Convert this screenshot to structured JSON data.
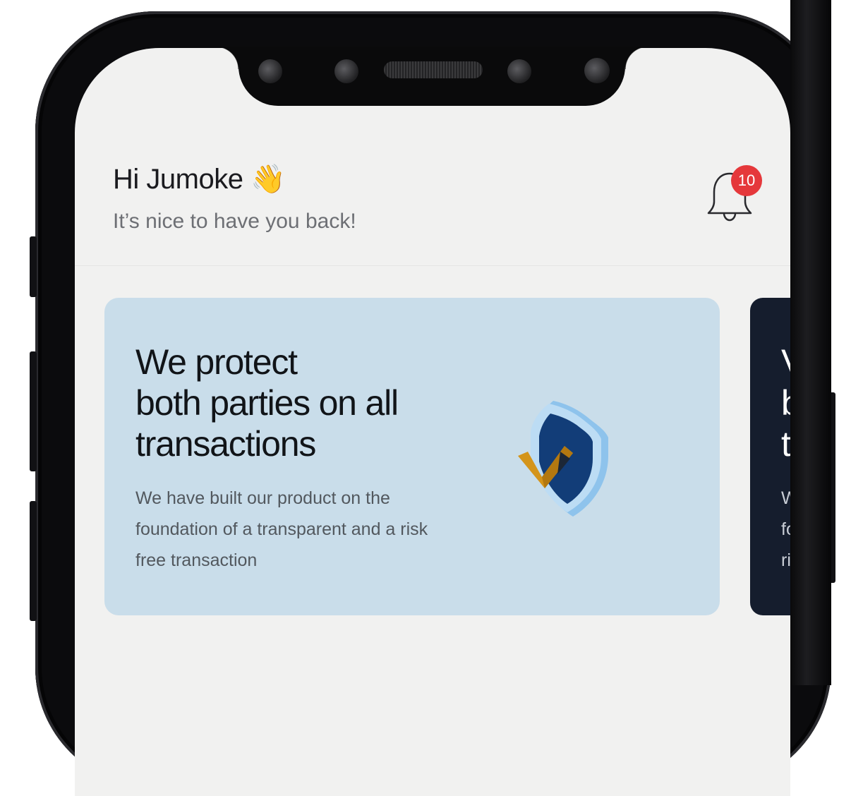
{
  "header": {
    "greeting": "Hi Jumoke",
    "greeting_emoji": "👋",
    "subtitle": "It’s nice to have you back!",
    "notification_count": "10"
  },
  "cards": [
    {
      "title_line1": "We protect",
      "title_line2": "both parties on all",
      "title_line3": "transactions",
      "body": "We have built our product on the foundation of a transparent and a risk free transaction",
      "icon": "shield-check-icon"
    },
    {
      "title_line1": "V",
      "title_line2": "b",
      "title_line3": "t",
      "body_lines": [
        "W",
        "fo",
        "ri"
      ]
    }
  ],
  "colors": {
    "screen_bg": "#f1f1f0",
    "card_primary_bg": "#c9ddea",
    "card_secondary_bg": "#151d2d",
    "badge": "#e5383b",
    "shield_dark": "#123d78",
    "shield_light": "#8ec3ec",
    "check": "#d4941a"
  }
}
